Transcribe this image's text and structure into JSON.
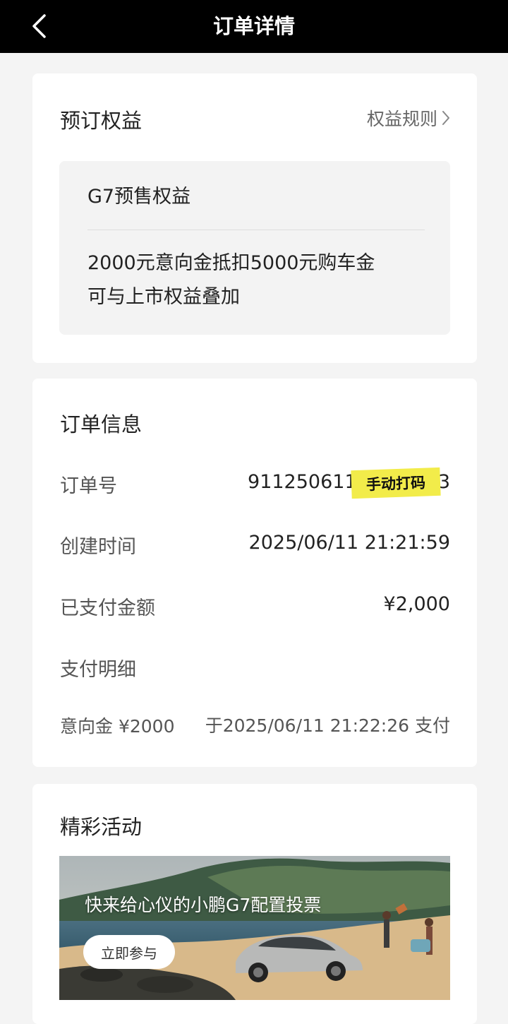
{
  "header": {
    "title": "订单详情"
  },
  "benefits": {
    "title": "预订权益",
    "rules_link": "权益规则",
    "name": "G7预售权益",
    "line1": "2000元意向金抵扣5000元购车金",
    "line2": "可与上市权益叠加"
  },
  "order": {
    "title": "订单信息",
    "order_no_label": "订单号",
    "order_no_value": "9112506115",
    "order_no_tail": "3",
    "redaction_sticker": "手动打码",
    "created_label": "创建时间",
    "created_value": "2025/06/11 21:21:59",
    "paid_label": "已支付金额",
    "paid_value": "¥2,000",
    "detail_label": "支付明细",
    "deposit_label": "意向金 ¥2000",
    "deposit_value": "于2025/06/11 21:22:26 支付"
  },
  "activities": {
    "title": "精彩活动",
    "banner_text": "快来给心仪的小鹏G7配置投票",
    "join_button": "立即参与"
  }
}
